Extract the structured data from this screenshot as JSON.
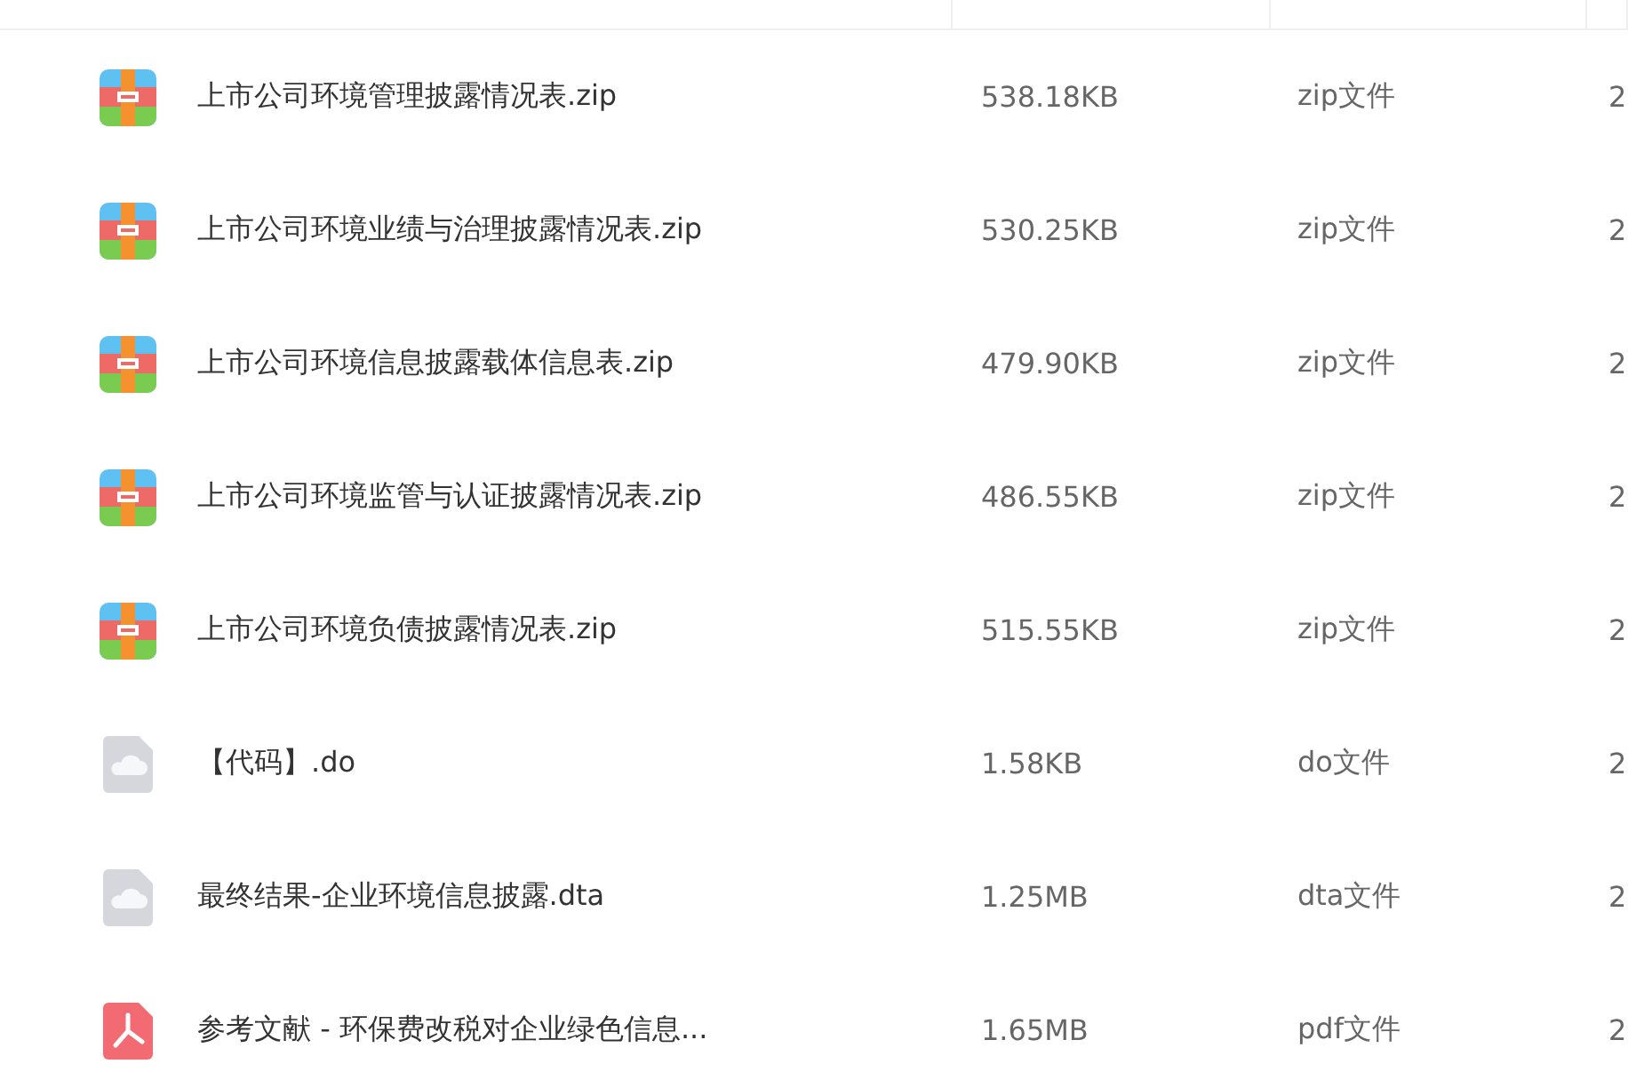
{
  "rows": [
    {
      "kind": "zip",
      "name": "上市公司环境管理披露情况表.zip",
      "size": "538.18KB",
      "type": "zip文件",
      "column_4": "2"
    },
    {
      "kind": "zip",
      "name": "上市公司环境业绩与治理披露情况表.zip",
      "size": "530.25KB",
      "type": "zip文件",
      "column_4": "2"
    },
    {
      "kind": "zip",
      "name": "上市公司环境信息披露载体信息表.zip",
      "size": "479.90KB",
      "type": "zip文件",
      "column_4": "2"
    },
    {
      "kind": "zip",
      "name": "上市公司环境监管与认证披露情况表.zip",
      "size": "486.55KB",
      "type": "zip文件",
      "column_4": "2"
    },
    {
      "kind": "zip",
      "name": "上市公司环境负债披露情况表.zip",
      "size": "515.55KB",
      "type": "zip文件",
      "column_4": "2"
    },
    {
      "kind": "cloud",
      "name": "【代码】.do",
      "size": "1.58KB",
      "type": "do文件",
      "column_4": "2"
    },
    {
      "kind": "cloud",
      "name": "最终结果-企业环境信息披露.dta",
      "size": "1.25MB",
      "type": "dta文件",
      "column_4": "2"
    },
    {
      "kind": "pdf",
      "name": "参考文献 - 环保费改税对企业绿色信息...",
      "size": "1.65MB",
      "type": "pdf文件",
      "column_4": "2"
    }
  ]
}
